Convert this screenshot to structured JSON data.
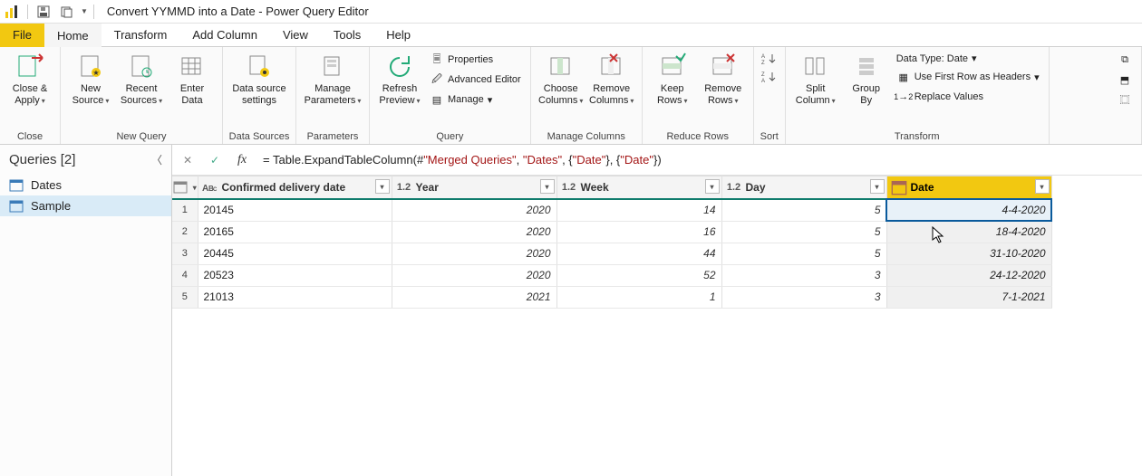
{
  "titlebar": {
    "title": "Convert YYMMD into a Date - Power Query Editor"
  },
  "tabs": {
    "file": "File",
    "home": "Home",
    "transform": "Transform",
    "add": "Add Column",
    "view": "View",
    "tools": "Tools",
    "help": "Help"
  },
  "ribbon": {
    "close_apply": "Close &\nApply",
    "new_source": "New\nSource",
    "recent_sources": "Recent\nSources",
    "enter_data": "Enter\nData",
    "data_source_settings": "Data source\nsettings",
    "manage_params": "Manage\nParameters",
    "refresh_preview": "Refresh\nPreview",
    "properties": "Properties",
    "advanced_editor": "Advanced Editor",
    "manage": "Manage",
    "choose_cols": "Choose\nColumns",
    "remove_cols": "Remove\nColumns",
    "keep_rows": "Keep\nRows",
    "remove_rows": "Remove\nRows",
    "split_col": "Split\nColumn",
    "group_by": "Group\nBy",
    "data_type": "Data Type: Date",
    "first_row": "Use First Row as Headers",
    "replace": "Replace Values",
    "g_close": "Close",
    "g_newq": "New Query",
    "g_ds": "Data Sources",
    "g_params": "Parameters",
    "g_query": "Query",
    "g_cols": "Manage Columns",
    "g_rows": "Reduce Rows",
    "g_sort": "Sort",
    "g_transform": "Transform"
  },
  "sidebar": {
    "header": "Queries [2]",
    "items": [
      "Dates",
      "Sample"
    ]
  },
  "formula": {
    "pre": "= Table.ExpandTableColumn(#",
    "s1": "\"Merged Queries\"",
    "c1": ", ",
    "s2": "\"Dates\"",
    "c2": ", {",
    "s3": "\"Date\"",
    "c3": "}, {",
    "s4": "\"Date\"",
    "c4": "})"
  },
  "columns": {
    "cdd": "Confirmed delivery date",
    "year": "Year",
    "week": "Week",
    "day": "Day",
    "date": "Date"
  },
  "rows": [
    {
      "n": "1",
      "cdd": "20145",
      "year": "2020",
      "week": "14",
      "day": "5",
      "date": "4-4-2020"
    },
    {
      "n": "2",
      "cdd": "20165",
      "year": "2020",
      "week": "16",
      "day": "5",
      "date": "18-4-2020"
    },
    {
      "n": "3",
      "cdd": "20445",
      "year": "2020",
      "week": "44",
      "day": "5",
      "date": "31-10-2020"
    },
    {
      "n": "4",
      "cdd": "20523",
      "year": "2020",
      "week": "52",
      "day": "3",
      "date": "24-12-2020"
    },
    {
      "n": "5",
      "cdd": "21013",
      "year": "2021",
      "week": "1",
      "day": "3",
      "date": "7-1-2021"
    }
  ]
}
